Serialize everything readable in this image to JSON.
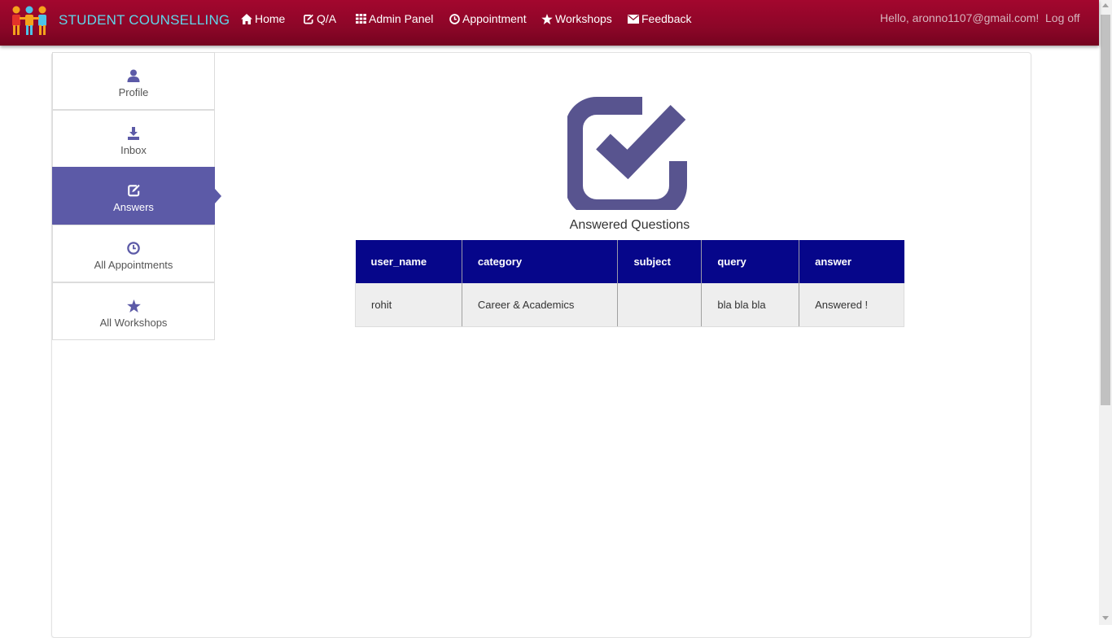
{
  "navbar": {
    "brand": "STUDENT COUNSELLING",
    "items": [
      {
        "label": "Home",
        "icon": "home-icon"
      },
      {
        "label": "Q/A",
        "icon": "edit-icon"
      },
      {
        "label": "Admin Panel",
        "icon": "grid-icon"
      },
      {
        "label": "Appointment",
        "icon": "clock-icon"
      },
      {
        "label": "Workshops",
        "icon": "star-icon"
      },
      {
        "label": "Feedback",
        "icon": "envelope-icon"
      }
    ],
    "greeting": "Hello, aronno1107@gmail.com!",
    "logoff": "Log off"
  },
  "sidebar": {
    "items": [
      {
        "label": "Profile",
        "icon": "user-icon",
        "active": false
      },
      {
        "label": "Inbox",
        "icon": "download-icon",
        "active": false
      },
      {
        "label": "Answers",
        "icon": "edit-icon",
        "active": true
      },
      {
        "label": "All Appointments",
        "icon": "clock-icon",
        "active": false
      },
      {
        "label": "All Workshops",
        "icon": "star-icon",
        "active": false
      }
    ]
  },
  "main": {
    "title": "Answered Questions",
    "table": {
      "headers": [
        "user_name",
        "category",
        "subject",
        "query",
        "answer"
      ],
      "rows": [
        [
          "rohit",
          "Career & Academics",
          "",
          "bla bla bla",
          "Answered !"
        ]
      ]
    }
  },
  "colors": {
    "navbar": "#8c0628",
    "brand_text": "#5fd7ea",
    "accent": "#5c5aa7",
    "table_header": "#06068a",
    "row_bg": "#eeeeee"
  }
}
